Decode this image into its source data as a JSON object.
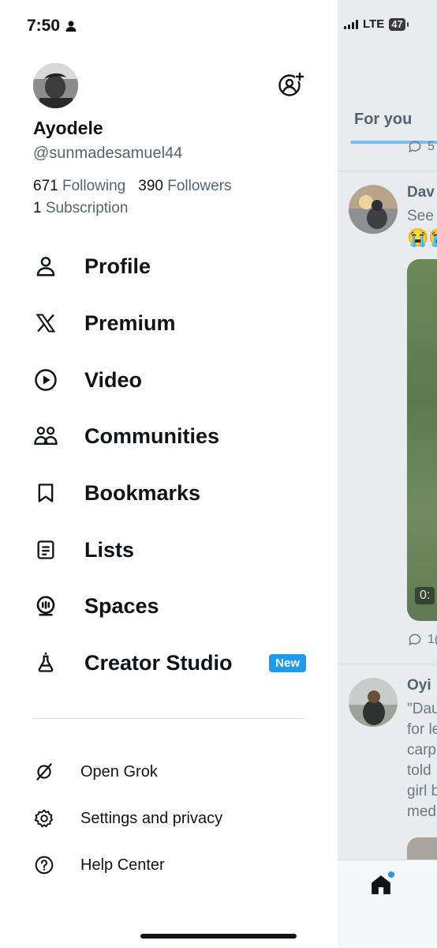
{
  "status_bar": {
    "time": "7:50",
    "network": "LTE",
    "battery": "47"
  },
  "profile": {
    "display_name": "Ayodele",
    "handle": "@sunmadesamuel44",
    "following_count": "671",
    "following_label": "Following",
    "followers_count": "390",
    "followers_label": "Followers",
    "subscription_count": "1",
    "subscription_label": "Subscription"
  },
  "menu": {
    "items": [
      {
        "label": "Profile",
        "icon": "person-icon"
      },
      {
        "label": "Premium",
        "icon": "x-logo-icon"
      },
      {
        "label": "Video",
        "icon": "play-circle-icon"
      },
      {
        "label": "Communities",
        "icon": "communities-icon"
      },
      {
        "label": "Bookmarks",
        "icon": "bookmark-icon"
      },
      {
        "label": "Lists",
        "icon": "list-icon"
      },
      {
        "label": "Spaces",
        "icon": "spaces-icon"
      },
      {
        "label": "Creator Studio",
        "icon": "flask-icon",
        "badge": "New"
      }
    ],
    "secondary": [
      {
        "label": "Open Grok",
        "icon": "grok-icon"
      },
      {
        "label": "Settings and privacy",
        "icon": "gear-icon"
      },
      {
        "label": "Help Center",
        "icon": "help-icon"
      }
    ]
  },
  "timeline": {
    "tab_label": "For you",
    "post1": {
      "name": "Dav",
      "text": "See",
      "reply_count": "5"
    },
    "post2": {
      "name": "Dav",
      "text": "See",
      "video_time": "0:",
      "reply_count": "1("
    },
    "post3": {
      "name": "Oyi",
      "lines": [
        "\"Dau",
        "for le",
        "carp",
        "told",
        "girl b",
        "med"
      ]
    }
  },
  "colors": {
    "accent": "#1d9bf0",
    "text_primary": "#0f1419",
    "text_secondary": "#536471"
  }
}
